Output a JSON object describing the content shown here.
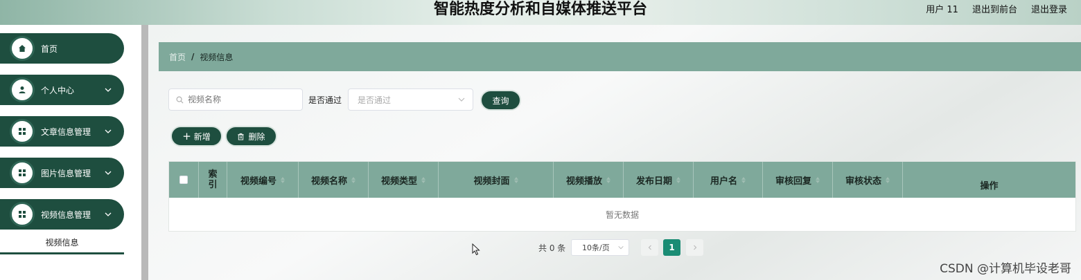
{
  "header": {
    "title": "智能热度分析和自媒体推送平台",
    "user_label": "用户 11",
    "back_to_front": "退出到前台",
    "logout": "退出登录"
  },
  "sidebar": {
    "items": [
      {
        "label": "首页",
        "icon": "home-icon"
      },
      {
        "label": "个人中心",
        "icon": "user-icon"
      },
      {
        "label": "文章信息管理",
        "icon": "grid-icon"
      },
      {
        "label": "图片信息管理",
        "icon": "grid-icon"
      },
      {
        "label": "视频信息管理",
        "icon": "grid-icon"
      }
    ],
    "submenu": [
      "视频信息"
    ]
  },
  "breadcrumb": {
    "home": "首页",
    "separator": "/",
    "current": "视频信息"
  },
  "search": {
    "name_placeholder": "视频名称",
    "pass_label": "是否通过",
    "pass_placeholder": "是否通过",
    "query_button": "查询"
  },
  "actions": {
    "add": "新增",
    "delete": "删除"
  },
  "table": {
    "columns": [
      "索引",
      "视频编号",
      "视频名称",
      "视频类型",
      "视频封面",
      "视频播放",
      "发布日期",
      "用户名",
      "审核回复",
      "审核状态",
      "操作"
    ],
    "empty_text": "暂无数据"
  },
  "pagination": {
    "total": "共 0 条",
    "page_size": "10条/页",
    "current_page": "1"
  },
  "watermark": "CSDN @计算机毕设老哥",
  "colors": {
    "primary": "#1e4e3f",
    "header_green": "#7fa99b",
    "page_active": "#1a8c74"
  }
}
